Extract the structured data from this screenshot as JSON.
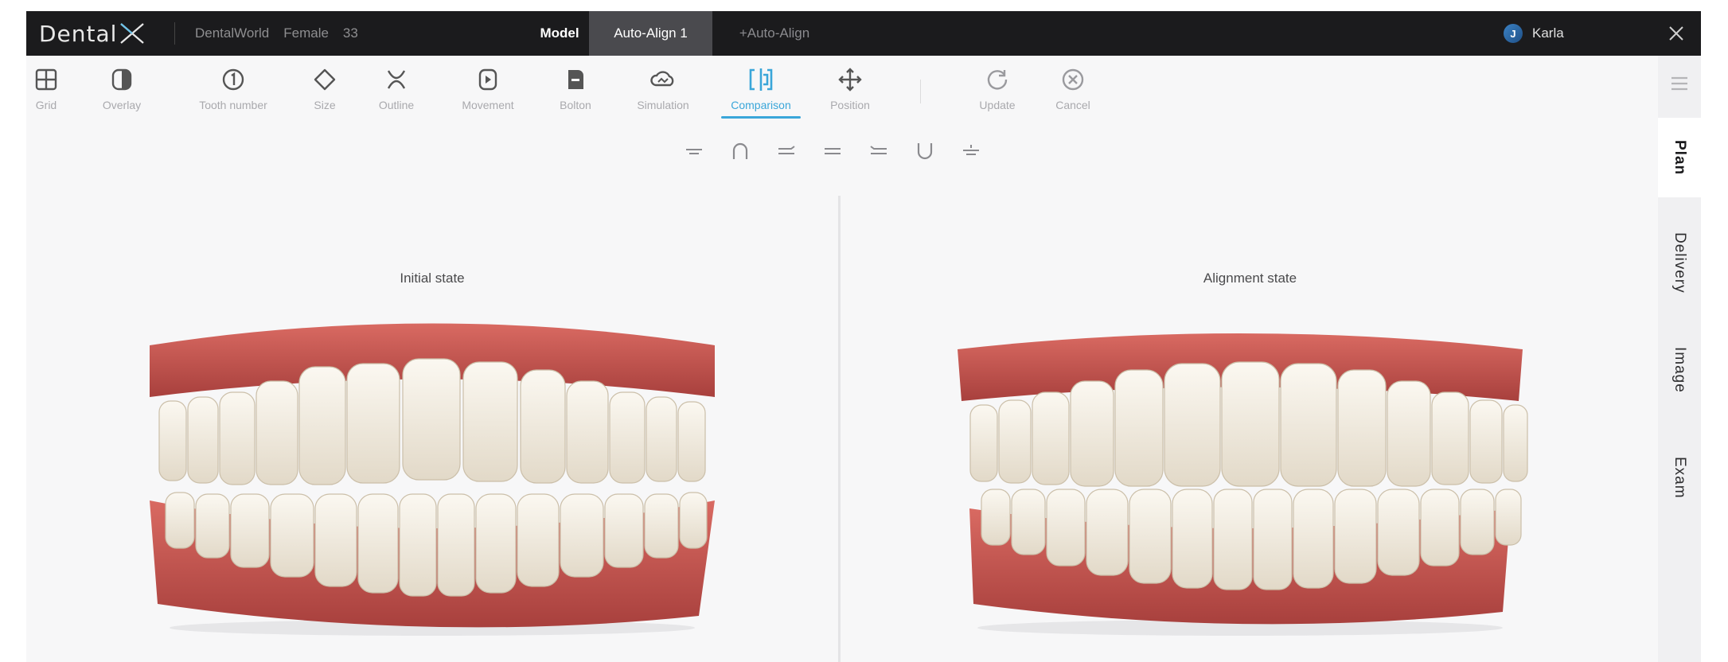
{
  "app": {
    "logo_text": "Dental",
    "logo_mark": "X"
  },
  "patient": {
    "clinic": "DentalWorld",
    "sex": "Female",
    "age": "33"
  },
  "tabs": {
    "model": "Model",
    "active": "Auto-Align 1",
    "add": "+Auto-Align"
  },
  "user": {
    "name": "Karla",
    "initial": "J"
  },
  "toolbar": {
    "grid": "Grid",
    "overlay": "Overlay",
    "tooth_numbers": "Tooth number",
    "size": "Size",
    "outline": "Outline",
    "movement": "Movement",
    "bolton": "Bolton",
    "simulation": "Simulation",
    "comparison": "Comparison",
    "position": "Position",
    "update": "Update",
    "cancel": "Cancel"
  },
  "views": [
    "front",
    "top",
    "left",
    "right",
    "bottom",
    "lower",
    "back"
  ],
  "rail": {
    "plan": "Plan",
    "delivery": "Delivery",
    "image": "Image",
    "exam": "Exam"
  },
  "panes": {
    "left_title": "Initial state",
    "right_title": "Alignment state"
  },
  "colors": {
    "accent": "#3aa6d9",
    "gum": "#c8524d",
    "tooth": "#f3eee4",
    "titlebar": "#1b1b1d"
  }
}
